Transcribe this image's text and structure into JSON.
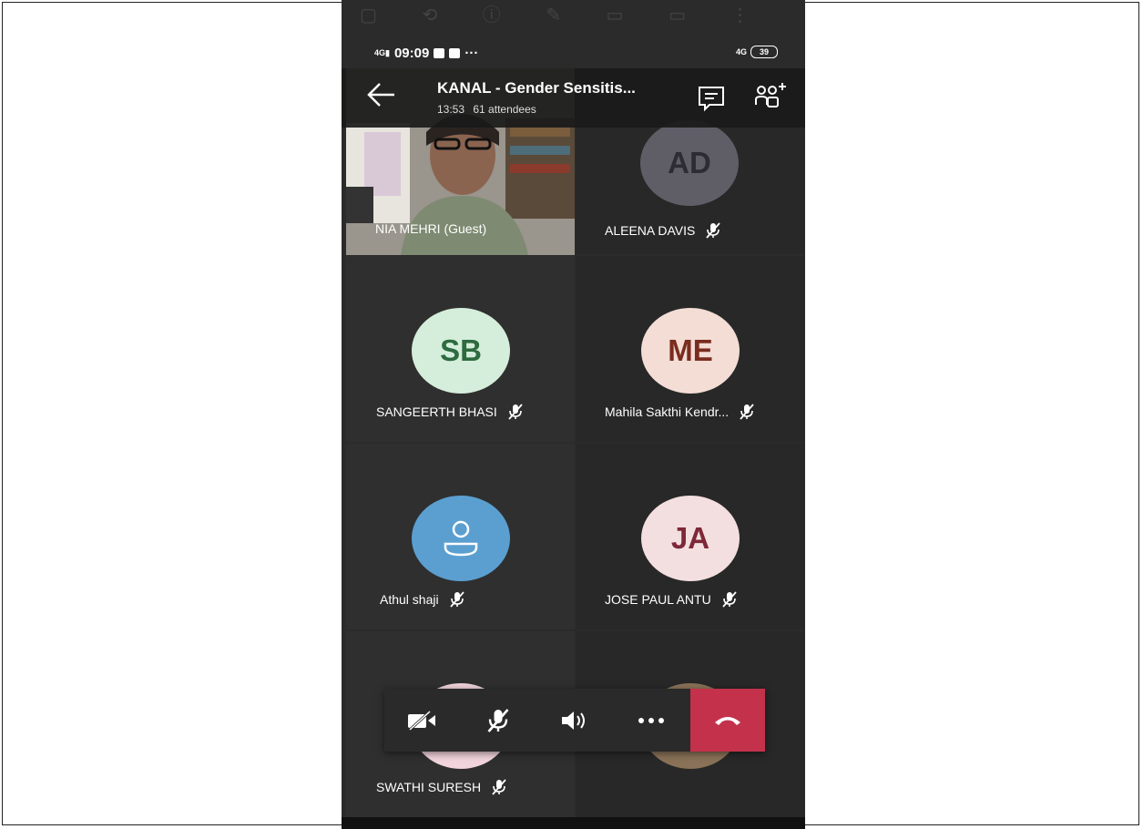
{
  "status_bar": {
    "time": "09:09",
    "signal_label": "4G",
    "right_signal_label": "4G",
    "battery": "39"
  },
  "header": {
    "title": "KANAL - Gender Sensitis...",
    "duration": "13:53",
    "attendees": "61 attendees",
    "icons": [
      "back-arrow-icon",
      "chat-icon",
      "add-people-icon"
    ]
  },
  "participants": [
    {
      "name": "NIA MEHRI (Guest)",
      "type": "video",
      "muted": false
    },
    {
      "name": "ALEENA DAVIS",
      "initials": "AD",
      "avatar_bg": "#5f5e67",
      "avatar_fg": "#2d2c33",
      "muted": true
    },
    {
      "name": "SANGEERTH BHASI",
      "initials": "SB",
      "avatar_bg": "#d5eedb",
      "avatar_fg": "#2e6b3f",
      "muted": true
    },
    {
      "name": "Mahila Sakthi Kendr...",
      "initials": "ME",
      "avatar_bg": "#f3ddd5",
      "avatar_fg": "#7a2c1f",
      "muted": true
    },
    {
      "name": "Athul shaji",
      "initials": "",
      "avatar_bg": "#5b9fd1",
      "avatar_fg": "#ffffff",
      "muted": true
    },
    {
      "name": "JOSE PAUL ANTU",
      "initials": "JA",
      "avatar_bg": "#f4dfe0",
      "avatar_fg": "#7d2838",
      "muted": true
    },
    {
      "name": "SWATHI SURESH",
      "initials": "",
      "avatar_bg": "#f2d4dc",
      "avatar_fg": "#7d2838",
      "muted": true
    },
    {
      "name": "",
      "initials": "",
      "avatar_bg": "#8a7258",
      "avatar_fg": "#ffffff",
      "muted": false
    }
  ],
  "controls": [
    "camera-off-icon",
    "mic-off-icon",
    "speaker-icon",
    "more-options-icon",
    "hang-up-icon"
  ],
  "colors": {
    "hangup": "#c4314b",
    "tile": "#2f2f2f"
  }
}
